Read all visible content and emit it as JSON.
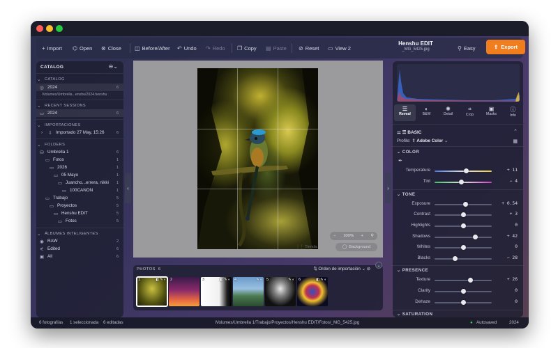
{
  "toolbar": {
    "import": "Import",
    "open": "Open",
    "close": "Close",
    "before_after": "Before/After",
    "undo": "Undo",
    "redo": "Redo",
    "copy": "Copy",
    "paste": "Paste",
    "reset": "Reset",
    "view": "View 2",
    "easy": "Easy",
    "export": "Export"
  },
  "window": {
    "title": "Henshu EDIT",
    "subtitle": "_MG_5425.jpg"
  },
  "sidebar": {
    "header": "CATALOG",
    "catalog_section": "CATALOG",
    "catalog_item": {
      "label": "2024",
      "count": "6"
    },
    "catalog_path": "/Volumes/Umbrella...enshu/2024.henshu",
    "recent_section": "RECENT SESSIONS",
    "recent_item": {
      "label": "2024",
      "count": "6"
    },
    "imports_section": "IMPORTACIONES",
    "import_item": {
      "label": "Importado 27 May, 15:26",
      "count": "6"
    },
    "folders_section": "FOLDERS",
    "folders": [
      {
        "label": "Umbrella 1",
        "count": "6"
      },
      {
        "label": "Fotos",
        "count": "1"
      },
      {
        "label": "2026",
        "count": "1"
      },
      {
        "label": "05 Mayo",
        "count": "1"
      },
      {
        "label": "Juancho...errera, nikki",
        "count": "1"
      },
      {
        "label": "100CANON",
        "count": "1"
      },
      {
        "label": "Trabajo",
        "count": "5"
      },
      {
        "label": "Proyectos",
        "count": "5"
      },
      {
        "label": "Henshu EDIT",
        "count": "5"
      },
      {
        "label": "Fotos",
        "count": "5"
      }
    ],
    "smart_section": "ÁLBUMES INTELIGENTES",
    "smart": [
      {
        "label": "RAW",
        "count": "2"
      },
      {
        "label": "Edited",
        "count": "6"
      },
      {
        "label": "All",
        "count": "6"
      }
    ]
  },
  "viewer": {
    "zoom": "100%",
    "background": "Background",
    "tienda": "Tienda"
  },
  "filmstrip": {
    "label": "PHOTOS",
    "count": "6",
    "sort": "Orden de importación",
    "thumbs": [
      "1",
      "2",
      "3",
      "4",
      "5",
      "6"
    ]
  },
  "right_panel": {
    "tabs": [
      "Reveal",
      "B&W",
      "Detail",
      "Crop",
      "Masks",
      "Info"
    ],
    "section": "BASIC",
    "profile_label": "Profile:",
    "profile_value": "Adobe Color",
    "color_section": "COLOR",
    "tone_section": "TONE",
    "presence_section": "PRESENCE",
    "saturation_section": "SATURATION",
    "sliders": {
      "temperature": {
        "label": "Temperature",
        "value": "+ 11",
        "pos": 0.56
      },
      "tint": {
        "label": "Tint",
        "value": "− 4",
        "pos": 0.47
      },
      "exposure": {
        "label": "Exposure",
        "value": "+ 0.54",
        "pos": 0.54
      },
      "contrast": {
        "label": "Contrast",
        "value": "+ 3",
        "pos": 0.51
      },
      "highlights": {
        "label": "Highlights",
        "value": "0",
        "pos": 0.5
      },
      "shadows": {
        "label": "Shadows",
        "value": "+ 42",
        "pos": 0.71
      },
      "whites": {
        "label": "Whites",
        "value": "0",
        "pos": 0.5
      },
      "blacks": {
        "label": "Blacks",
        "value": "− 28",
        "pos": 0.36
      },
      "texture": {
        "label": "Texture",
        "value": "+ 26",
        "pos": 0.63
      },
      "clarity": {
        "label": "Clarity",
        "value": "0",
        "pos": 0.5
      },
      "dehaze": {
        "label": "Dehaze",
        "value": "0",
        "pos": 0.5
      }
    }
  },
  "status": {
    "photos": "6 fotografías",
    "selected": "1 seleccionada",
    "edited": "6 editadas",
    "path": "/Volumes/Umbrella 1/Trabajo/Proyectos/Henshu EDIT/Fotos/_MG_5425.jpg",
    "autosave": "Autosaved",
    "year": "2024"
  },
  "colors": {
    "accent": "#f07d1e",
    "autosave_dot": "#3ecf5a"
  }
}
